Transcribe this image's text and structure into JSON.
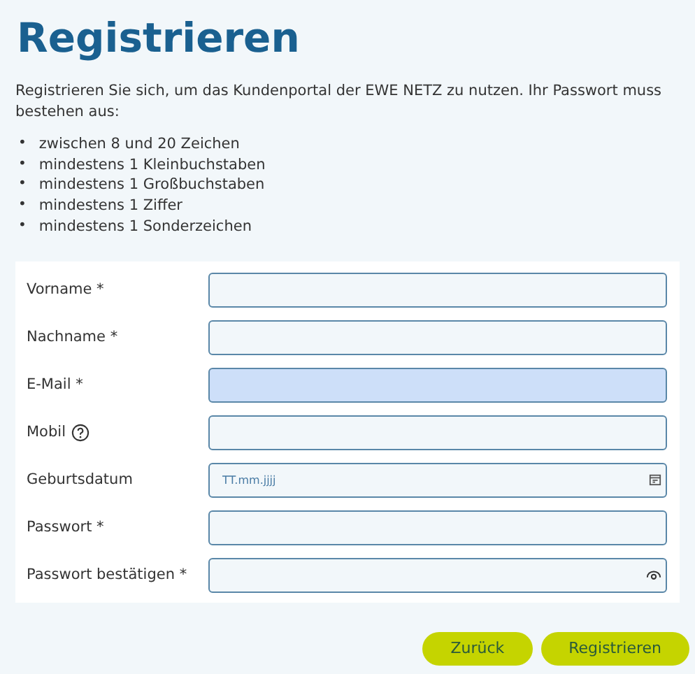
{
  "title": "Registrieren",
  "intro": "Registrieren Sie sich, um das Kundenportal der EWE NETZ zu nutzen. Ihr Passwort muss bestehen aus:",
  "requirements": [
    {
      "bullet": "•",
      "text": "zwischen 8 und 20 Zeichen"
    },
    {
      "bullet": "•",
      "text": "mindestens 1 Kleinbuchstaben"
    },
    {
      "bullet": "•",
      "text": "mindestens 1 Großbuchstaben"
    },
    {
      "bullet": "•",
      "text": "mindestens 1 Ziffer"
    },
    {
      "bullet": "•",
      "text": "mindestens 1 Sonderzeichen"
    }
  ],
  "fields": [
    {
      "label": "Vorname *",
      "kind": "text",
      "highlighted": false
    },
    {
      "label": "Nachname *",
      "kind": "text",
      "highlighted": false
    },
    {
      "label": "E-Mail *",
      "kind": "text",
      "highlighted": true
    },
    {
      "label": "Mobil",
      "kind": "help",
      "highlighted": false
    },
    {
      "label": "Geburtsdatum",
      "kind": "date",
      "placeholder": "TT.mm.jjjj",
      "highlighted": false
    },
    {
      "label": "Passwort *",
      "kind": "text",
      "highlighted": false
    },
    {
      "label": "Passwort bestätigen *",
      "kind": "password",
      "highlighted": false
    }
  ],
  "buttons": [
    "Zurück",
    "Registrieren"
  ]
}
